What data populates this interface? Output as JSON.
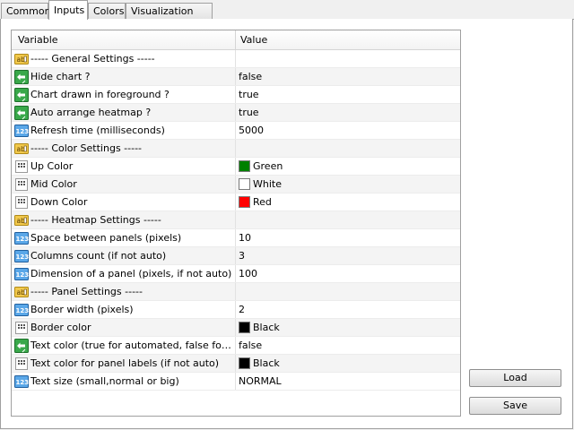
{
  "tabs": [
    "Common",
    "Inputs",
    "Colors",
    "Visualization"
  ],
  "active_tab": "Inputs",
  "grid": {
    "headers": [
      "Variable",
      "Value"
    ],
    "rows": [
      {
        "type": "ab",
        "variable": "-----     General Settings     -----",
        "value": ""
      },
      {
        "type": "bool",
        "variable": "Hide chart ?",
        "value": "false"
      },
      {
        "type": "bool",
        "variable": "Chart drawn in foreground ?",
        "value": "true"
      },
      {
        "type": "bool",
        "variable": "Auto arrange heatmap ?",
        "value": "true"
      },
      {
        "type": "num",
        "variable": "Refresh time (milliseconds)",
        "value": "5000"
      },
      {
        "type": "ab",
        "variable": "-----     Color Settings     -----",
        "value": ""
      },
      {
        "type": "color",
        "variable": "Up Color",
        "value": "Green",
        "color": "#008000"
      },
      {
        "type": "color",
        "variable": "Mid Color",
        "value": "White",
        "color": "#ffffff"
      },
      {
        "type": "color",
        "variable": "Down Color",
        "value": "Red",
        "color": "#ff0000"
      },
      {
        "type": "ab",
        "variable": "-----     Heatmap Settings     -----",
        "value": ""
      },
      {
        "type": "num",
        "variable": "Space between panels (pixels)",
        "value": "10"
      },
      {
        "type": "num",
        "variable": "Columns count (if not auto)",
        "value": "3"
      },
      {
        "type": "num",
        "variable": "Dimension of a panel (pixels, if not auto)",
        "value": "100"
      },
      {
        "type": "ab",
        "variable": "-----     Panel Settings     -----",
        "value": ""
      },
      {
        "type": "num",
        "variable": "Border width (pixels)",
        "value": "2"
      },
      {
        "type": "color",
        "variable": "Border color",
        "value": "Black",
        "color": "#000000"
      },
      {
        "type": "bool",
        "variable": "Text color (true for automated, false for manual)",
        "value": "false"
      },
      {
        "type": "color",
        "variable": "Text color for panel labels (if not auto)",
        "value": "Black",
        "color": "#000000"
      },
      {
        "type": "num",
        "variable": "Text size (small,normal or big)",
        "value": "NORMAL"
      }
    ]
  },
  "buttons": {
    "load": "Load",
    "save": "Save"
  }
}
